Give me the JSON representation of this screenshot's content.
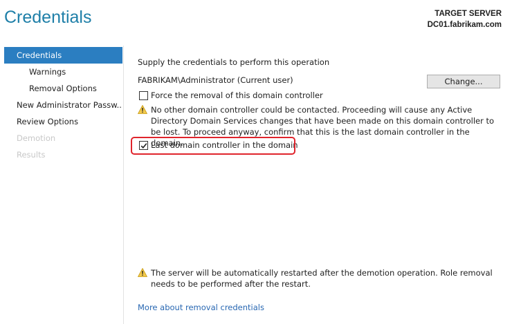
{
  "header": {
    "title": "Credentials",
    "target_label": "TARGET SERVER",
    "target_server": "DC01.fabrikam.com"
  },
  "nav": {
    "items": [
      {
        "label": "Credentials",
        "state": "active"
      },
      {
        "label": "Warnings",
        "state": "normal"
      },
      {
        "label": "Removal Options",
        "state": "normal"
      },
      {
        "label": "New Administrator Passw...",
        "state": "normal"
      },
      {
        "label": "Review Options",
        "state": "normal"
      },
      {
        "label": "Demotion",
        "state": "disabled"
      },
      {
        "label": "Results",
        "state": "disabled"
      }
    ]
  },
  "main": {
    "supply_text": "Supply the credentials to perform this operation",
    "user": "FABRIKAM\\Administrator (Current user)",
    "change_label": "Change...",
    "force_removal": {
      "label": "Force the removal of this domain controller",
      "checked": false
    },
    "warning_contact": "No other domain controller could be contacted.  Proceeding will cause any Active Directory Domain Services changes that have been made on this domain controller to be lost.  To proceed anyway, confirm that this is the last domain controller in the domain.",
    "last_dc": {
      "label": "Last domain controller in the domain",
      "checked": true
    },
    "restart_warning": "The server will be automatically restarted after the demotion operation. Role removal needs to be performed after the restart.",
    "more_link": "More about removal credentials"
  },
  "colors": {
    "title": "#1e7fa8",
    "nav_active_bg": "#2b7ec1",
    "highlight": "#e0242c",
    "link": "#2867b2",
    "warning_icon": "#f2c94c"
  }
}
